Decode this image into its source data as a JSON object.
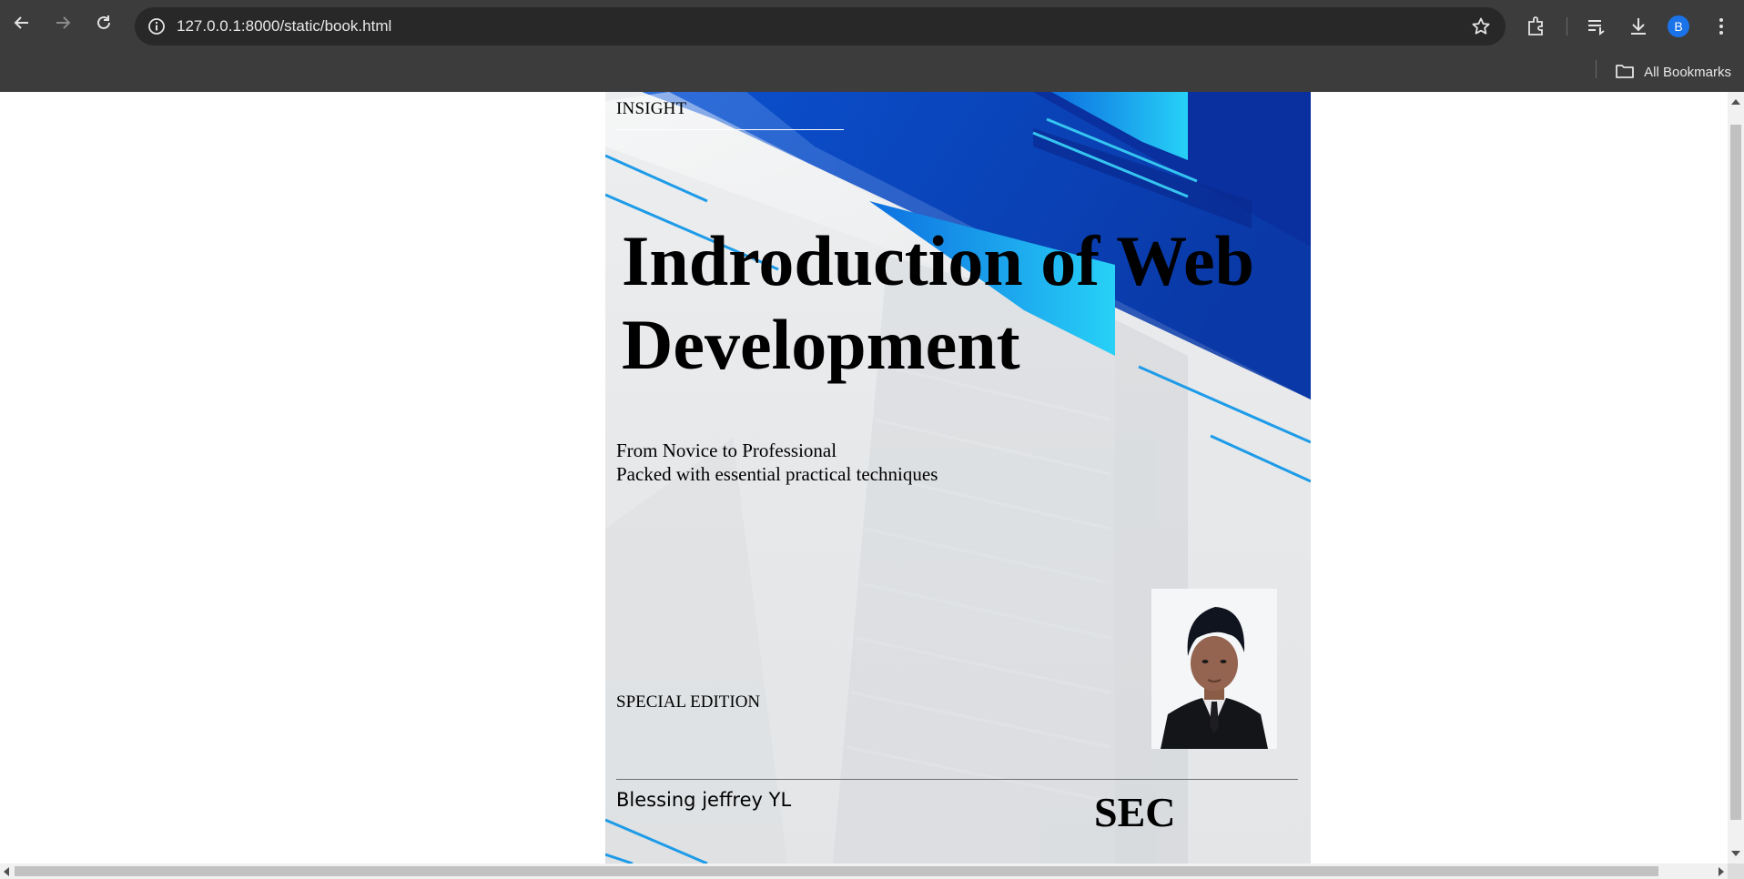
{
  "browser": {
    "url": "127.0.0.1:8000/static/book.html",
    "profile_initial": "B",
    "bookmarks_label": "All Bookmarks",
    "icons": [
      "back-icon",
      "forward-icon",
      "reload-icon",
      "site-info-icon",
      "bookmark-star-icon",
      "extensions-icon",
      "reading-list-icon",
      "download-icon",
      "kebab-menu-icon",
      "folder-icon"
    ]
  },
  "cover": {
    "series": "INSIGHT",
    "title_line1": "Indroduction of Web",
    "title_line2": "Development",
    "subtitle_line1": "From Novice to Professional",
    "subtitle_line2": "Packed with essential practical techniques",
    "edition": "SPECIAL EDITION",
    "author": "Blessing jeffrey YL",
    "publisher": "SEC",
    "colors": {
      "navy": "#0a2f9e",
      "blue": "#0b4fd0",
      "cyan": "#1fc2f0",
      "background": "#e7e9eb"
    }
  }
}
